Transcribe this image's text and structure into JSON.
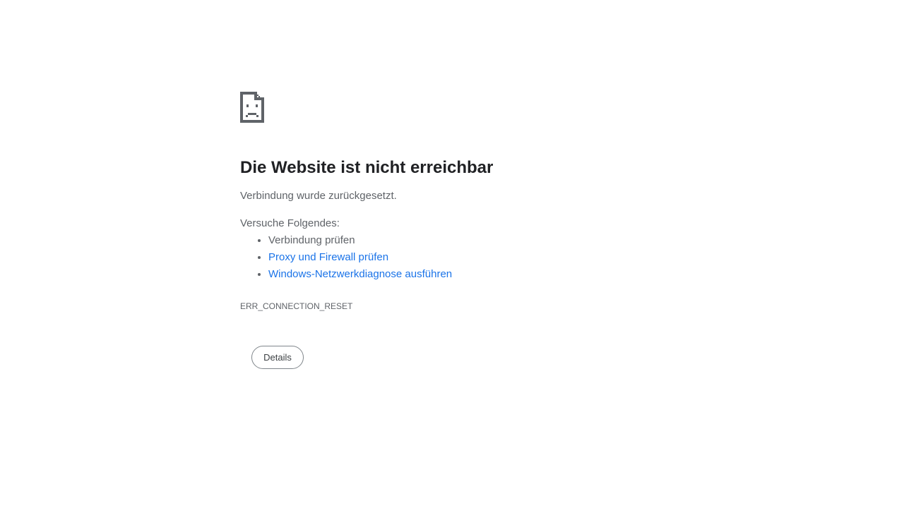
{
  "icon": "sad-page-icon",
  "title": "Die Website ist nicht erreichbar",
  "summary": "Verbindung wurde zurückgesetzt.",
  "suggestions": {
    "heading": "Versuche Folgendes:",
    "items": [
      {
        "label": "Verbindung prüfen",
        "is_link": false
      },
      {
        "label": "Proxy und Firewall prüfen",
        "is_link": true
      },
      {
        "label": "Windows-Netzwerkdiagnose ausführen",
        "is_link": true
      }
    ]
  },
  "error_code": "ERR_CONNECTION_RESET",
  "details_button": {
    "label": "Details"
  },
  "colors": {
    "title": "#202124",
    "body_text": "#5f6368",
    "link": "#1a73e8",
    "button_border": "#80868b"
  }
}
